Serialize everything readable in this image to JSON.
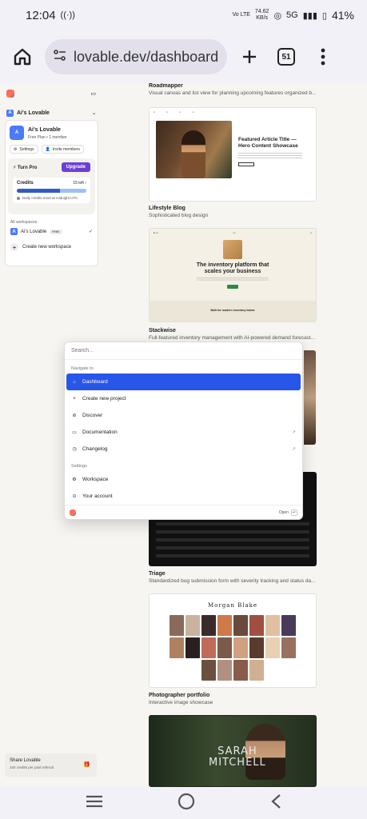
{
  "status": {
    "time": "12:04",
    "net_top": "74.62",
    "net_unit": "KB/s",
    "net_type": "Vo LTE",
    "signal": "5G",
    "battery": "41%"
  },
  "browser": {
    "url": "lovable.dev/dashboard",
    "tab_count": "51"
  },
  "sidebar": {
    "workspace_label": "Ai's Lovable",
    "workspace_initial": "A",
    "card": {
      "name": "Ai's Lovable",
      "plan": "Free Plan • 1 member",
      "settings": "Settings",
      "invite": "Invite members"
    },
    "pro": {
      "label": "Turn Pro",
      "upgrade": "Upgrade"
    },
    "credits": {
      "label": "Credits",
      "left": "15 left",
      "used_fraction": 0.62,
      "reset": "Daily credits reset at midnight UTC"
    },
    "all_workspaces": "All workspaces",
    "ws_item": "Ai's Lovable",
    "ws_badge": "FREE",
    "create": "Create new workspace",
    "share_title": "Share Lovable",
    "share_sub": "100 credits per paid referral"
  },
  "gallery": [
    {
      "title": "Roadmapper",
      "desc": "Visual canvas and list view for planning upcoming features organized b..."
    },
    {
      "title": "Lifestyle Blog",
      "desc": "Sophisticated blog design"
    },
    {
      "title": "Stackwise",
      "desc": "Full-featured inventory management with AI-powered demand forecast..."
    },
    {
      "title": "Triage",
      "desc": "Standardized bug submission form with severity tracking and status da..."
    },
    {
      "title": "Photographer portfolio",
      "desc": "Interactive image showcase"
    }
  ],
  "thumbs": {
    "blog_headline": "Featured Article Title — Hero Content Showcase",
    "stack_headline_1": "The inventory platform that",
    "stack_headline_2": "scales your business",
    "stack_footer": "Built for modern inventory teams",
    "photog_name": "Morgan Blake",
    "sarah_1": "SARAH",
    "sarah_2": "MITCHELL"
  },
  "palette": {
    "placeholder": "Search...",
    "nav_section": "Navigate to",
    "items": [
      {
        "label": "Dashboard",
        "icon": "home-icon"
      },
      {
        "label": "Create new project",
        "icon": "plus-icon"
      },
      {
        "label": "Discover",
        "icon": "compass-icon"
      },
      {
        "label": "Documentation",
        "icon": "book-icon"
      },
      {
        "label": "Changelog",
        "icon": "clock-icon"
      }
    ],
    "settings_section": "Settings",
    "settings_items": [
      {
        "label": "Workspace",
        "icon": "gear-icon"
      },
      {
        "label": "Your account",
        "icon": "user-icon"
      }
    ],
    "open": "Open"
  },
  "colors": {
    "accent": "#2756e8",
    "upgrade": "#6b3fd6"
  }
}
